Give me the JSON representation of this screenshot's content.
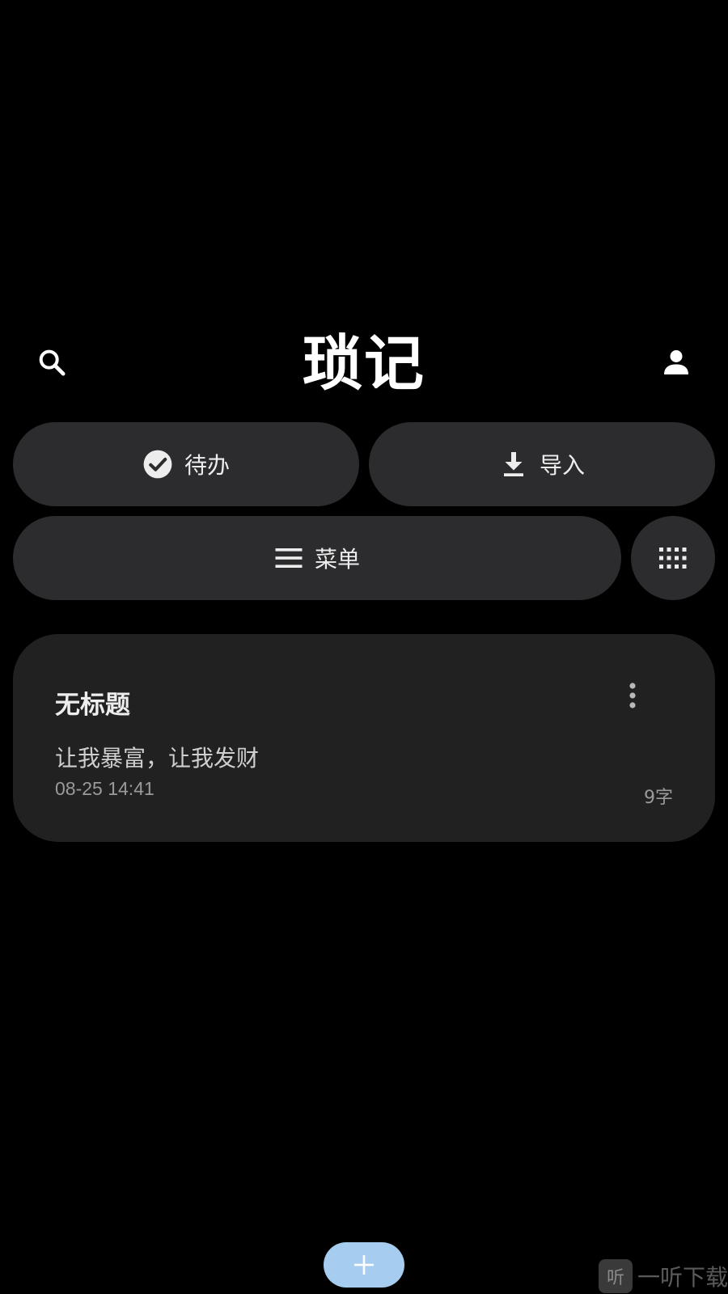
{
  "app": {
    "title": "琐记"
  },
  "header": {
    "search_icon": "search-icon",
    "account_icon": "account-icon"
  },
  "actions": {
    "todo": {
      "label": "待办",
      "icon": "check-circle-icon"
    },
    "import": {
      "label": "导入",
      "icon": "download-icon"
    },
    "menu": {
      "label": "菜单",
      "icon": "hamburger-menu-icon"
    },
    "grid": {
      "icon": "grid-view-icon"
    }
  },
  "notes": [
    {
      "title": "无标题",
      "body": "让我暴富，让我发财",
      "time": "08-25 14:41",
      "count": "9字"
    }
  ],
  "fab": {
    "label": "+",
    "color": "#a6cdf0"
  },
  "watermark": {
    "logo": "听",
    "text": "一听下载"
  },
  "colors": {
    "background": "#000000",
    "pill": "#2c2c2e",
    "card": "#212121",
    "accent": "#a6cdf0"
  }
}
